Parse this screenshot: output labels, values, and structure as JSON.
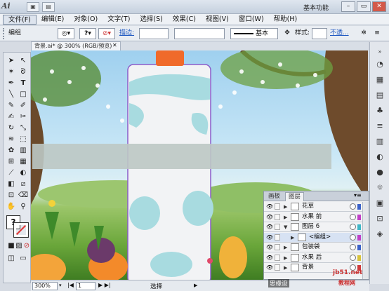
{
  "titlebar": {
    "logo": "Ai",
    "workspace": "基本功能",
    "min": "–",
    "restore": "▭",
    "close": "✕"
  },
  "menu": [
    "文件(F)",
    "编辑(E)",
    "对象(O)",
    "文字(T)",
    "选择(S)",
    "效果(C)",
    "视图(V)",
    "窗口(W)",
    "帮助(H)"
  ],
  "control": {
    "selection": "编组",
    "stroke_label": "描边:",
    "style_basic": "基本",
    "style_label": "样式:",
    "opacity_link": "不透..."
  },
  "document": {
    "tab": "背景.ai* @ 300% (RGB/预览)",
    "zoom": "300%",
    "page": "1",
    "status": "选择"
  },
  "layers": {
    "tabs": [
      "画板",
      "图层"
    ],
    "rows": [
      {
        "name": "花草",
        "color": "#3b62c9"
      },
      {
        "name": "水果 前",
        "color": "#c03fc7"
      },
      {
        "name": "图层 6",
        "color": "#3fb6c7"
      },
      {
        "name": "<编组>",
        "color": "#c03fc7"
      },
      {
        "name": "包装袋",
        "color": "#3b62c9"
      },
      {
        "name": "水果 后",
        "color": "#d8c23a"
      },
      {
        "name": "背景",
        "color": "#d03a3a"
      }
    ]
  },
  "watermark": {
    "site": "jb51.net",
    "brand": "教程网",
    "tag": "思缘设"
  },
  "colors": {
    "package_shape": "#f2f3f5",
    "package_spots": "#a8dbe0",
    "cap": "#f06a2a",
    "selection_path": "#8b5cc9"
  }
}
